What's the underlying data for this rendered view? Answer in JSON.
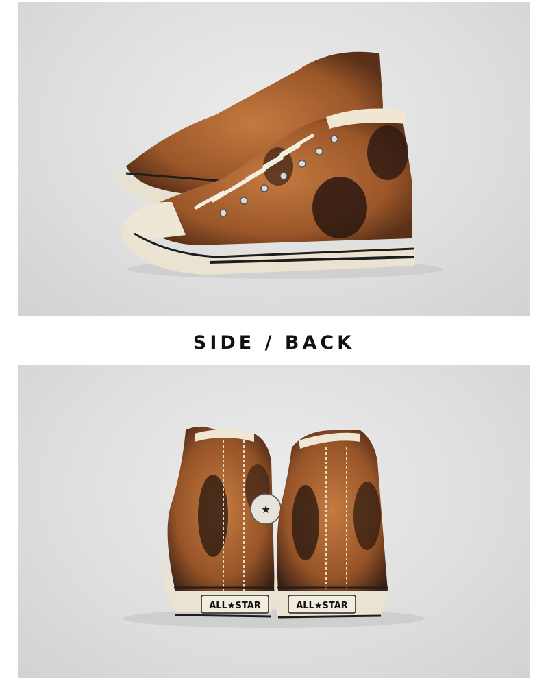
{
  "heading": "SIDE / BACK",
  "photos": [
    {
      "subject": "Pair of high-top canvas sneakers, side view",
      "colors": {
        "upper": "#b36a35",
        "dark": "#241510",
        "sole": "#ebe3d1"
      }
    },
    {
      "subject": "Pair of high-top canvas sneakers, back view",
      "colors": {
        "upper": "#b36a35",
        "dark": "#241510",
        "sole": "#ebe3d1"
      }
    }
  ],
  "heel_label": "ALL★STAR"
}
